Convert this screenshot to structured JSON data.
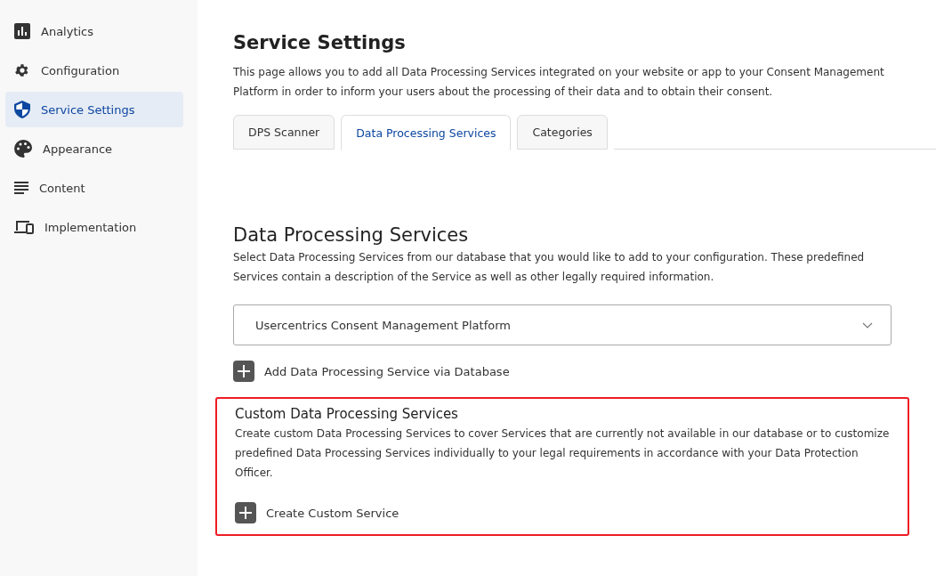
{
  "sidebar": {
    "items": [
      {
        "label": "Analytics",
        "selected": false
      },
      {
        "label": "Configuration",
        "selected": false
      },
      {
        "label": "Service Settings",
        "selected": true
      },
      {
        "label": "Appearance",
        "selected": false
      },
      {
        "label": "Content",
        "selected": false
      },
      {
        "label": "Implementation",
        "selected": false
      }
    ]
  },
  "page": {
    "title": "Service Settings",
    "description": "This page allows you to add all Data Processing Services integrated on your website or app to your Consent Management Platform in order to inform your users about the processing of their data and to obtain their consent."
  },
  "tabs": [
    {
      "label": "DPS Scanner",
      "selected": false
    },
    {
      "label": "Data Processing Services",
      "selected": true
    },
    {
      "label": "Categories",
      "selected": false
    }
  ],
  "dps_section": {
    "heading": "Data Processing Services",
    "description": "Select Data Processing Services from our database that you would like to add to your configuration. These predefined Services contain a description of the Service as well as other legally required information.",
    "dropdown": {
      "value": "Usercentrics Consent Management Platform"
    },
    "add_button": "Add Data Processing Service via Database"
  },
  "custom_section": {
    "highlighted": true,
    "heading": "Custom Data Processing Services",
    "description": "Create custom Data Processing Services to cover Services that are currently not available in our database or to customize predefined Data Processing Services individually to your legal requirements in accordance with your Data Protection Officer.",
    "create_button": "Create Custom Service"
  }
}
